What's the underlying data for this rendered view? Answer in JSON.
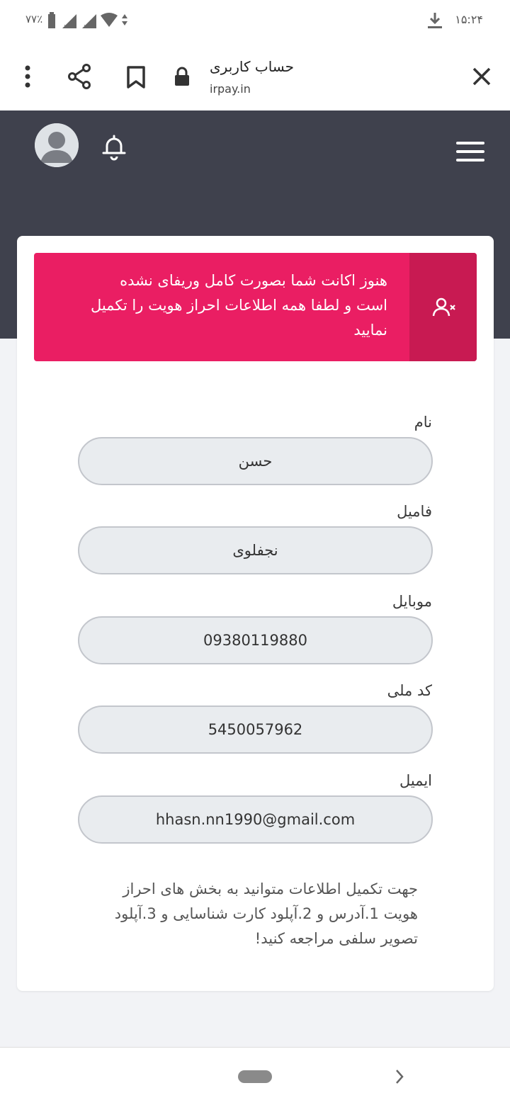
{
  "status_bar": {
    "time": "۱۵:۲۴",
    "battery": "۷۷٪"
  },
  "browser": {
    "title": "حساب کاربری",
    "url": "irpay.in"
  },
  "alert": {
    "message": "هنوز اکانت شما بصورت کامل وریفای نشده است و لطفا همه اطلاعات احراز هویت را تکمیل نمایید"
  },
  "form": {
    "fields": [
      {
        "label": "نام",
        "value": "حسن"
      },
      {
        "label": "فامیل",
        "value": "نجفلوی"
      },
      {
        "label": "موبایل",
        "value": "09380119880"
      },
      {
        "label": "کد ملی",
        "value": "5450057962"
      },
      {
        "label": "ایمیل",
        "value": "hhasn.nn1990@gmail.com"
      }
    ]
  },
  "help_text": "جهت تکمیل اطلاعات متوانید به بخش های احراز هویت 1.آدرس و 2.آپلود کارت شناسایی و 3.آپلود تصویر سلفی مراجعه کنید!",
  "colors": {
    "header_bg": "#3f414d",
    "alert_bg": "#ea1e63",
    "alert_icon_bg": "#c81a52",
    "input_bg": "#e9ecef"
  }
}
